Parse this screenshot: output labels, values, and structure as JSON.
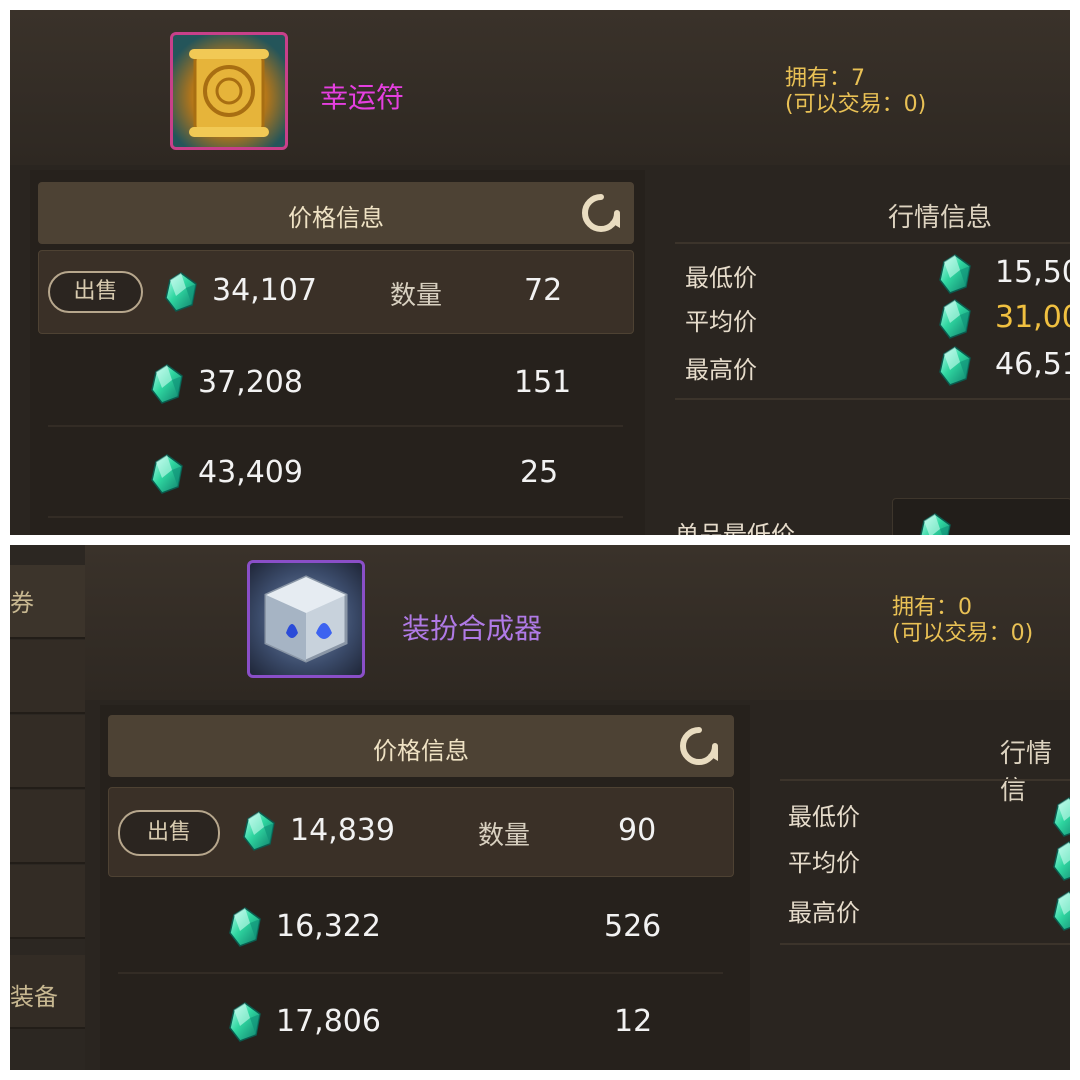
{
  "listings": [
    {
      "item_name": "幸运符",
      "item_name_color": "#e53fe0",
      "icon": "scroll-icon",
      "owned_text": "拥有：7",
      "tradable_text": "(可以交易：0)",
      "price_header": "价格信息",
      "sell_label": "出售",
      "qty_label": "数量",
      "rows": [
        {
          "price": "34,107",
          "qty": "72"
        },
        {
          "price": "37,208",
          "qty": "151"
        },
        {
          "price": "43,409",
          "qty": "25"
        }
      ],
      "market": {
        "title": "行情信息",
        "labels": [
          "最低价",
          "平均价",
          "最高价"
        ],
        "values": [
          "15,50",
          "31,00",
          "46,51"
        ],
        "single_low_label": "单品最低价"
      }
    },
    {
      "item_name": "装扮合成器",
      "item_name_color": "#b07ae6",
      "icon": "cube-icon",
      "owned_text": "拥有：0",
      "tradable_text": "(可以交易：0)",
      "price_header": "价格信息",
      "sell_label": "出售",
      "qty_label": "数量",
      "rows": [
        {
          "price": "14,839",
          "qty": "90"
        },
        {
          "price": "16,322",
          "qty": "526"
        },
        {
          "price": "17,806",
          "qty": "12"
        }
      ],
      "market": {
        "title": "行情信",
        "labels": [
          "最低价",
          "平均价",
          "最高价"
        ]
      },
      "sidebar": {
        "top": "券",
        "bottom": "装备"
      }
    }
  ],
  "colors": {
    "gem": "#2fd6a0",
    "avg_value": "#f0c040"
  }
}
